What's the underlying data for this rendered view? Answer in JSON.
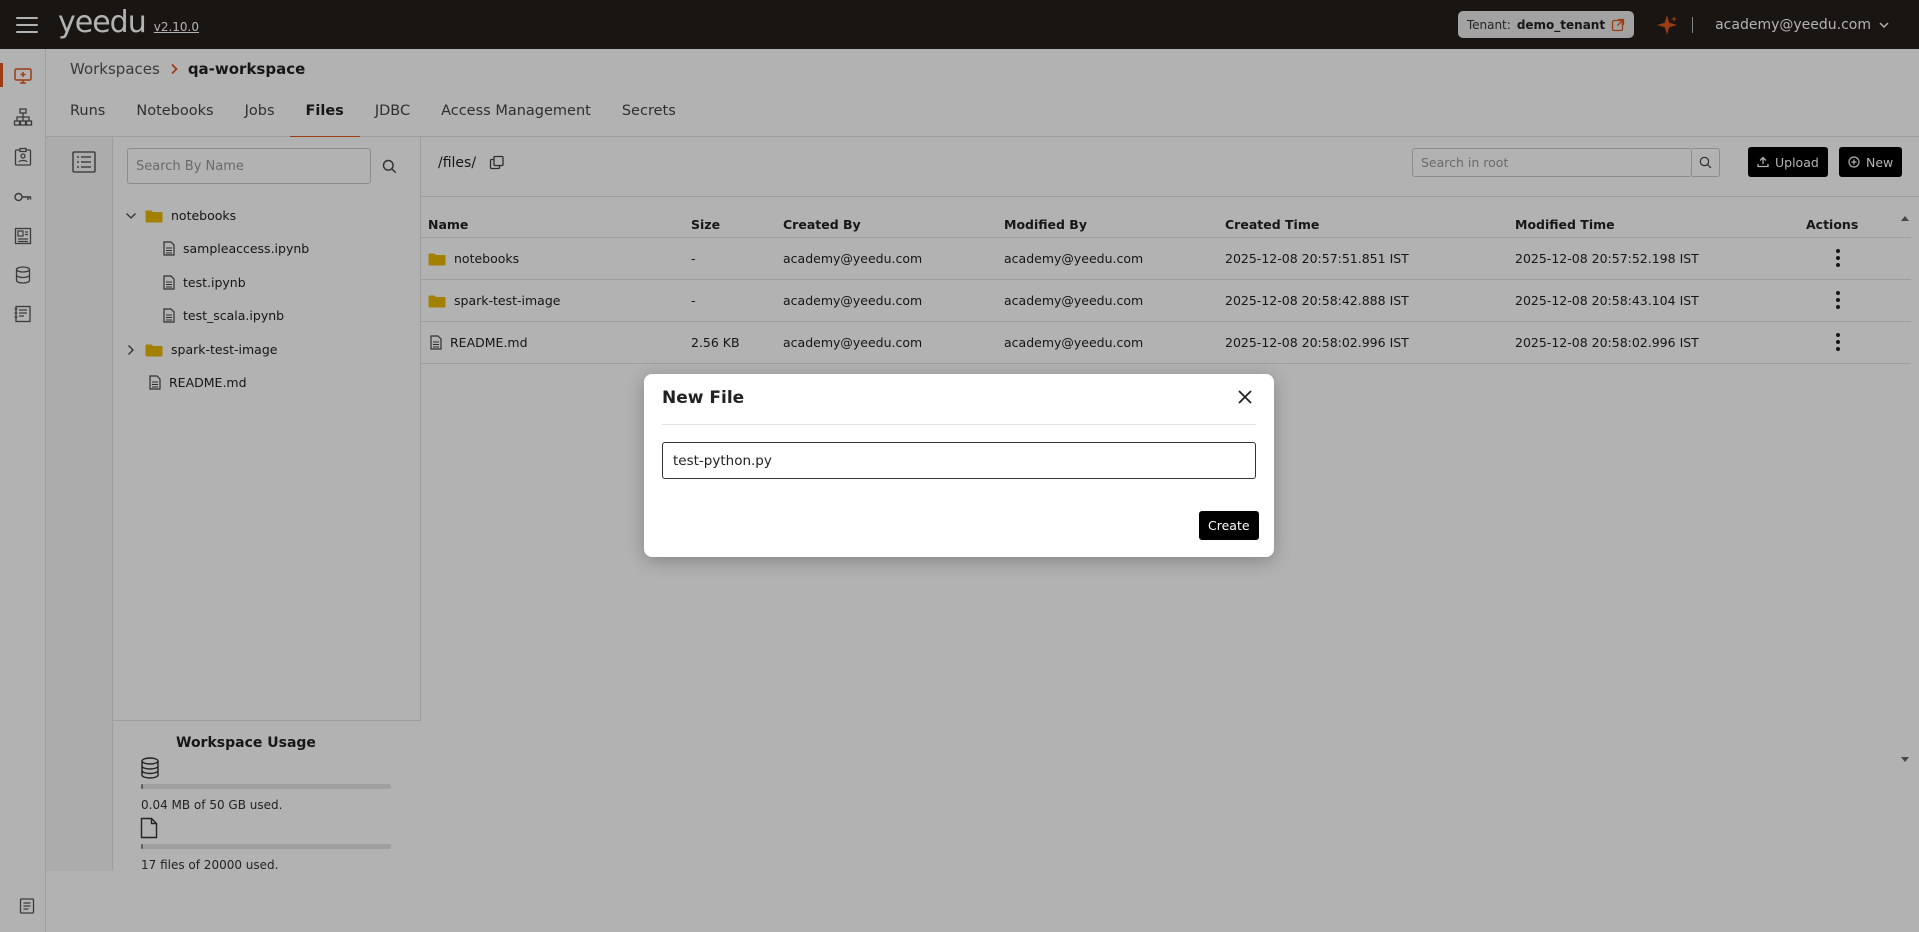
{
  "app": {
    "logo": "yeedu",
    "version": "v2.10.0",
    "tenant_label": "Tenant:",
    "tenant_value": "demo_tenant",
    "user_email": "academy@yeedu.com"
  },
  "colors": {
    "accent": "#e2571d",
    "topbar": "#231f1c",
    "folder": "#e8b800"
  },
  "rail": {
    "icons": [
      "workspaces-icon",
      "clusters-icon",
      "jobs-icon",
      "credentials-icon",
      "dashboard-icon",
      "database-icon",
      "logs-icon",
      "docs-icon"
    ]
  },
  "breadcrumb": {
    "parent": "Workspaces",
    "current": "qa-workspace"
  },
  "tabs": [
    {
      "label": "Runs"
    },
    {
      "label": "Notebooks"
    },
    {
      "label": "Jobs"
    },
    {
      "label": "Files",
      "active": true
    },
    {
      "label": "JDBC"
    },
    {
      "label": "Access Management"
    },
    {
      "label": "Secrets"
    }
  ],
  "tree": {
    "search_placeholder": "Search By Name",
    "items": [
      {
        "label": "notebooks",
        "type": "folder",
        "expanded": true
      },
      {
        "label": "sampleaccess.ipynb",
        "type": "file"
      },
      {
        "label": "test.ipynb",
        "type": "file"
      },
      {
        "label": "test_scala.ipynb",
        "type": "file"
      },
      {
        "label": "spark-test-image",
        "type": "folder",
        "expanded": false
      },
      {
        "label": "README.md",
        "type": "file"
      }
    ]
  },
  "usage": {
    "title": "Workspace Usage",
    "storage_text": "0.04 MB of 50 GB used.",
    "storage_fraction": 0.0008,
    "files_text": "17 files of 20000 used.",
    "files_fraction": 0.00085
  },
  "main": {
    "path": "/files/",
    "search_placeholder": "Search in root",
    "upload_label": "Upload",
    "new_label": "New",
    "columns": [
      "Name",
      "Size",
      "Created By",
      "Modified By",
      "Created Time",
      "Modified Time",
      "Actions"
    ],
    "rows": [
      {
        "name": "notebooks",
        "type": "folder",
        "size": "-",
        "created_by": "academy@yeedu.com",
        "modified_by": "academy@yeedu.com",
        "created_time": "2025-12-08 20:57:51.851 IST",
        "modified_time": "2025-12-08 20:57:52.198 IST"
      },
      {
        "name": "spark-test-image",
        "type": "folder",
        "size": "-",
        "created_by": "academy@yeedu.com",
        "modified_by": "academy@yeedu.com",
        "created_time": "2025-12-08 20:58:42.888 IST",
        "modified_time": "2025-12-08 20:58:43.104 IST"
      },
      {
        "name": "README.md",
        "type": "file",
        "size": "2.56 KB",
        "created_by": "academy@yeedu.com",
        "modified_by": "academy@yeedu.com",
        "created_time": "2025-12-08 20:58:02.996 IST",
        "modified_time": "2025-12-08 20:58:02.996 IST"
      }
    ]
  },
  "modal": {
    "title": "New File",
    "input_value": "test-python.py",
    "create_label": "Create"
  }
}
